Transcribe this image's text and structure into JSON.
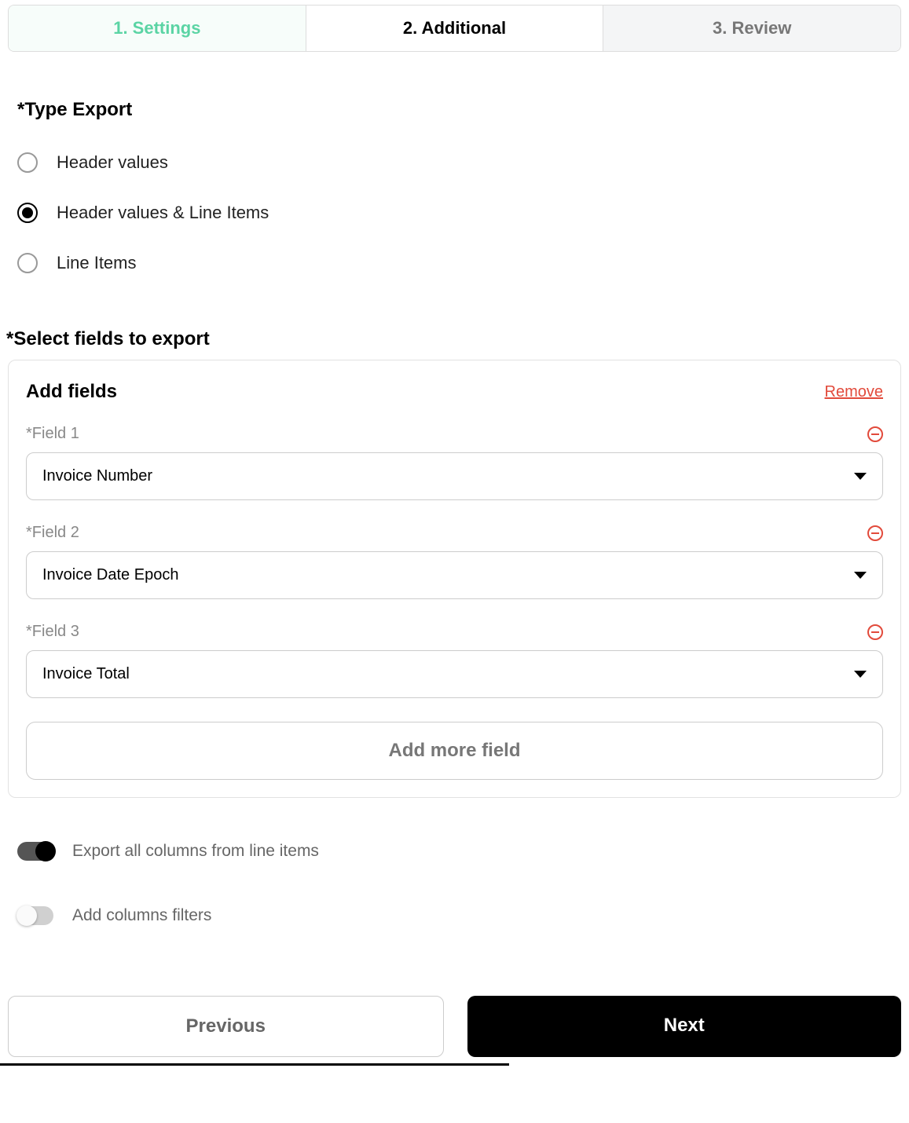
{
  "tabs": {
    "settings": "1. Settings",
    "additional": "2. Additional",
    "review": "3. Review"
  },
  "typeExport": {
    "label": "*Type Export",
    "options": {
      "headerValues": "Header values",
      "headerAndLine": "Header values & Line Items",
      "lineItems": "Line Items"
    }
  },
  "selectFields": {
    "label": "*Select fields to export",
    "addFieldsTitle": "Add fields",
    "removeLink": "Remove",
    "fields": [
      {
        "label": "*Field 1",
        "value": "Invoice Number"
      },
      {
        "label": "*Field 2",
        "value": "Invoice Date Epoch"
      },
      {
        "label": "*Field 3",
        "value": "Invoice Total"
      }
    ],
    "addMore": "Add more field"
  },
  "toggles": {
    "exportAll": "Export all columns from line items",
    "addFilters": "Add columns filters"
  },
  "footer": {
    "previous": "Previous",
    "next": "Next"
  }
}
